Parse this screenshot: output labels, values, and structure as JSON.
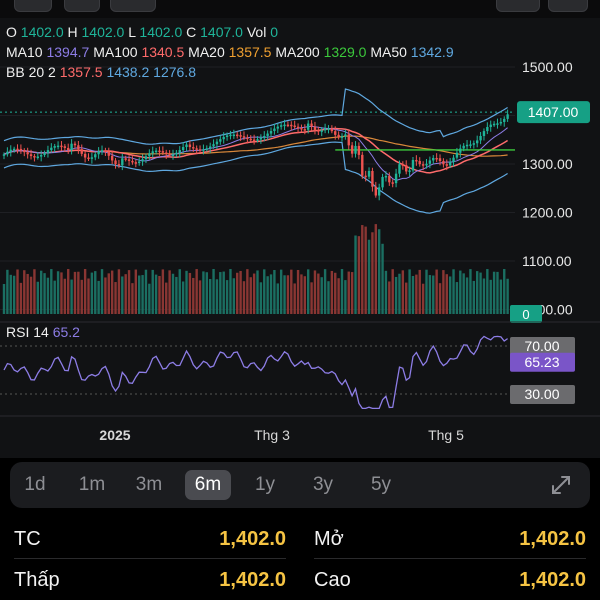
{
  "ohlc": {
    "o_label": "O",
    "o": "1402.0",
    "h_label": "H",
    "h": "1402.0",
    "l_label": "L",
    "l": "1402.0",
    "c_label": "C",
    "c": "1407.0",
    "vol_label": "Vol",
    "vol": "0"
  },
  "ma": [
    {
      "label": "MA10",
      "value": "1394.7",
      "color": "#8d7de6"
    },
    {
      "label": "MA100",
      "value": "1340.5",
      "color": "#ff6b6b"
    },
    {
      "label": "MA20",
      "value": "1357.5",
      "color": "#f0a030"
    },
    {
      "label": "MA200",
      "value": "1329.0",
      "color": "#3cc93c"
    },
    {
      "label": "MA50",
      "value": "1342.9",
      "color": "#5fa8e0"
    }
  ],
  "bb": {
    "label": "BB 20 2",
    "mid": "1357.5",
    "upper": "1438.2",
    "lower": "1276.8",
    "mid_color": "#ff6b6b",
    "upper_color": "#5fa8e0",
    "lower_color": "#5fa8e0"
  },
  "price_axis": [
    "1500.00",
    "1400.00",
    "1300.00",
    "1200.00",
    "1100.00",
    "1000.00"
  ],
  "last_price_tag": "1407.00",
  "volume_tag": "0",
  "rsi": {
    "label": "RSI 14",
    "value": "65.2",
    "color": "#8d7de6",
    "tag_upper": "70.00",
    "tag_value": "65.23",
    "tag_lower": "30.00"
  },
  "time_axis": [
    "2025",
    "Thg 3",
    "Thg 5"
  ],
  "timeframes": [
    {
      "label": "1d",
      "active": false
    },
    {
      "label": "1m",
      "active": false
    },
    {
      "label": "3m",
      "active": false
    },
    {
      "label": "6m",
      "active": true
    },
    {
      "label": "1y",
      "active": false
    },
    {
      "label": "3y",
      "active": false
    },
    {
      "label": "5y",
      "active": false
    }
  ],
  "stats": [
    {
      "label": "TC",
      "value": "1,402.0"
    },
    {
      "label": "Mở",
      "value": "1,402.0"
    },
    {
      "label": "Thấp",
      "value": "1,402.0"
    },
    {
      "label": "Cao",
      "value": "1,402.0"
    }
  ],
  "colors": {
    "up": "#1fb59a",
    "down": "#ef5350",
    "value": "#f6c443",
    "rsi": "#8d7de6",
    "band": "#5fa8e0"
  },
  "icons": {
    "expand": "expand-arrows-icon"
  }
}
